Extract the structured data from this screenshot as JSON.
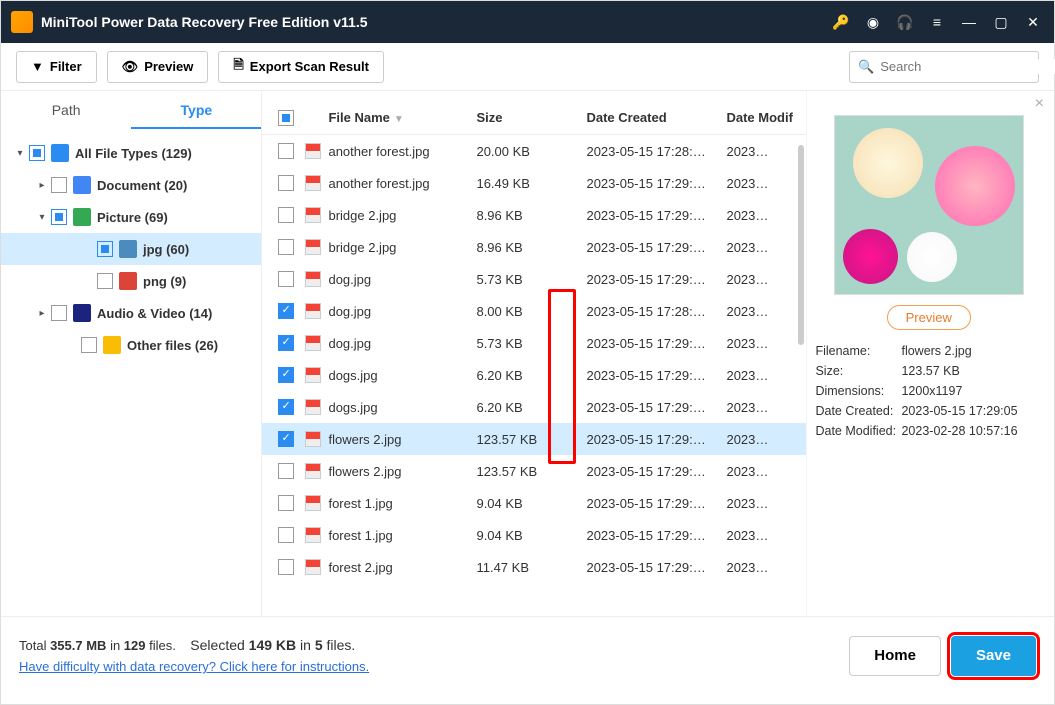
{
  "titlebar": {
    "app_title": "MiniTool Power Data Recovery Free Edition v11.5"
  },
  "toolbar": {
    "filter_label": "Filter",
    "preview_label": "Preview",
    "export_label": "Export Scan Result",
    "search_placeholder": "Search"
  },
  "sidebar": {
    "tabs": {
      "path": "Path",
      "type": "Type"
    },
    "tree": [
      {
        "id": "all",
        "label": "All File Types (129)",
        "depth": 0,
        "arrow": "▾",
        "check": "some",
        "icon": "ic-monitor"
      },
      {
        "id": "doc",
        "label": "Document (20)",
        "depth": 1,
        "arrow": "▸",
        "check": "",
        "icon": "ic-doc"
      },
      {
        "id": "pic",
        "label": "Picture (69)",
        "depth": 1,
        "arrow": "▾",
        "check": "some",
        "icon": "ic-pic"
      },
      {
        "id": "jpg",
        "label": "jpg (60)",
        "depth": 2,
        "arrow": "",
        "check": "some",
        "icon": "ic-jpg",
        "selected": true
      },
      {
        "id": "png",
        "label": "png (9)",
        "depth": 2,
        "arrow": "",
        "check": "",
        "icon": "ic-png"
      },
      {
        "id": "av",
        "label": "Audio & Video (14)",
        "depth": 1,
        "arrow": "▸",
        "check": "",
        "icon": "ic-av"
      },
      {
        "id": "other",
        "label": "Other files (26)",
        "depth": 1,
        "arrow": "",
        "check": "",
        "icon": "ic-other",
        "extra_indent": true
      }
    ]
  },
  "list": {
    "headers": {
      "name": "File Name",
      "size": "Size",
      "created": "Date Created",
      "modified": "Date Modif"
    },
    "rows": [
      {
        "checked": false,
        "name": "another forest.jpg",
        "size": "20.00 KB",
        "created": "2023-05-15 17:28:…",
        "modified": "2023…"
      },
      {
        "checked": false,
        "name": "another forest.jpg",
        "size": "16.49 KB",
        "created": "2023-05-15 17:29:…",
        "modified": "2023…"
      },
      {
        "checked": false,
        "name": "bridge 2.jpg",
        "size": "8.96 KB",
        "created": "2023-05-15 17:29:…",
        "modified": "2023…"
      },
      {
        "checked": false,
        "name": "bridge 2.jpg",
        "size": "8.96 KB",
        "created": "2023-05-15 17:29:…",
        "modified": "2023…"
      },
      {
        "checked": false,
        "name": "dog.jpg",
        "size": "5.73 KB",
        "created": "2023-05-15 17:29:…",
        "modified": "2023…"
      },
      {
        "checked": true,
        "name": "dog.jpg",
        "size": "8.00 KB",
        "created": "2023-05-15 17:28:…",
        "modified": "2023…"
      },
      {
        "checked": true,
        "name": "dog.jpg",
        "size": "5.73 KB",
        "created": "2023-05-15 17:29:…",
        "modified": "2023…"
      },
      {
        "checked": true,
        "name": "dogs.jpg",
        "size": "6.20 KB",
        "created": "2023-05-15 17:29:…",
        "modified": "2023…"
      },
      {
        "checked": true,
        "name": "dogs.jpg",
        "size": "6.20 KB",
        "created": "2023-05-15 17:29:…",
        "modified": "2023…"
      },
      {
        "checked": true,
        "name": "flowers 2.jpg",
        "size": "123.57 KB",
        "created": "2023-05-15 17:29:…",
        "modified": "2023…",
        "selected": true
      },
      {
        "checked": false,
        "name": "flowers 2.jpg",
        "size": "123.57 KB",
        "created": "2023-05-15 17:29:…",
        "modified": "2023…"
      },
      {
        "checked": false,
        "name": "forest 1.jpg",
        "size": "9.04 KB",
        "created": "2023-05-15 17:29:…",
        "modified": "2023…"
      },
      {
        "checked": false,
        "name": "forest 1.jpg",
        "size": "9.04 KB",
        "created": "2023-05-15 17:29:…",
        "modified": "2023…"
      },
      {
        "checked": false,
        "name": "forest 2.jpg",
        "size": "11.47 KB",
        "created": "2023-05-15 17:29:…",
        "modified": "2023…"
      }
    ]
  },
  "preview": {
    "button_label": "Preview",
    "labels": {
      "filename": "Filename:",
      "size": "Size:",
      "dimensions": "Dimensions:",
      "created": "Date Created:",
      "modified": "Date Modified:"
    },
    "values": {
      "filename": "flowers 2.jpg",
      "size": "123.57 KB",
      "dimensions": "1200x1197",
      "created": "2023-05-15 17:29:05",
      "modified": "2023-02-28 10:57:16"
    }
  },
  "footer": {
    "total_prefix": "Total ",
    "total_size": "355.7 MB",
    "total_mid": " in ",
    "total_count": "129",
    "total_suffix": " files.",
    "sel_prefix": "Selected ",
    "sel_size": "149 KB",
    "sel_mid": " in ",
    "sel_count": "5",
    "sel_suffix": " files.",
    "help_link": "Have difficulty with data recovery? Click here for instructions.",
    "home_label": "Home",
    "save_label": "Save"
  }
}
